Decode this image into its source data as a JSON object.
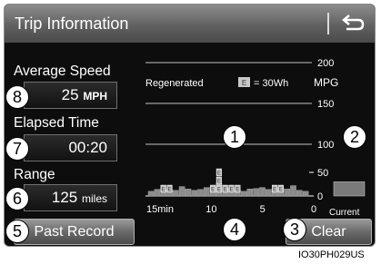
{
  "header": {
    "title": "Trip Information",
    "back_icon": "return-arrow-icon"
  },
  "stats": {
    "average_speed": {
      "label": "Average Speed",
      "value": "25",
      "unit": "MPH"
    },
    "elapsed_time": {
      "label": "Elapsed Time",
      "value": "00:20"
    },
    "range": {
      "label": "Range",
      "value": "125",
      "unit": "miles"
    }
  },
  "buttons": {
    "past_record": "Past Record",
    "clear": "Clear"
  },
  "callouts": [
    "1",
    "2",
    "3",
    "4",
    "5",
    "6",
    "7",
    "8"
  ],
  "legend": {
    "regenerated": "Regenerated",
    "e_glyph": "E",
    "e_value": "= 30Wh",
    "mpg": "MPG"
  },
  "current_label": "Current",
  "chart_data": {
    "type": "bar",
    "ylabel": "MPG",
    "yticks": [
      200,
      150,
      100,
      50,
      0
    ],
    "ylim": [
      0,
      200
    ],
    "xticks": [
      "15min",
      "10",
      "5",
      "0"
    ],
    "xlim": [
      15,
      0
    ],
    "series": [
      {
        "values": [
          10,
          14,
          16,
          13,
          12,
          20,
          15,
          12,
          14,
          18,
          20,
          27,
          18,
          17,
          14,
          10,
          15,
          16,
          18,
          14,
          16,
          20,
          15,
          22,
          12,
          10
        ]
      }
    ],
    "current_value": 30,
    "regenerated_counts": [
      0,
      0,
      1,
      1,
      0,
      0,
      0,
      0,
      0,
      0,
      1,
      3,
      1,
      1,
      1,
      0,
      0,
      0,
      0,
      0,
      1,
      1,
      0,
      0,
      0,
      0
    ]
  },
  "colors": {
    "bar": "#8c8c8c",
    "current_bar": "#7a7a7a",
    "e_badge": "#c8c8c8"
  },
  "image_code": "IO30PH029US"
}
